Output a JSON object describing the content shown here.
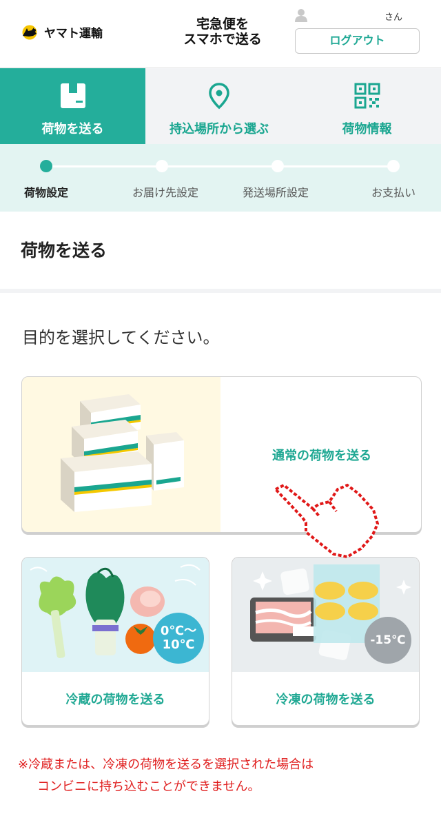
{
  "header": {
    "logo_text": "ヤマト運輸",
    "title_line1": "宅急便を",
    "title_line2": "スマホで送る",
    "user_suffix": "さん",
    "logout_label": "ログアウト"
  },
  "tabs": [
    {
      "label": "荷物を送る",
      "icon": "box-icon",
      "active": true
    },
    {
      "label": "持込場所から選ぶ",
      "icon": "location-pin-icon",
      "active": false
    },
    {
      "label": "荷物情報",
      "icon": "qr-code-icon",
      "active": false
    }
  ],
  "steps": [
    {
      "label": "荷物設定",
      "active": true
    },
    {
      "label": "お届け先設定",
      "active": false
    },
    {
      "label": "発送場所設定",
      "active": false
    },
    {
      "label": "お支払い",
      "active": false
    }
  ],
  "page_title": "荷物を送る",
  "instruction": "目的を選択してください。",
  "options": {
    "normal": {
      "label": "通常の荷物を送る"
    },
    "cold": {
      "label": "冷蔵の荷物を送る",
      "temp_line1": "0℃〜",
      "temp_line2": "10℃"
    },
    "frozen": {
      "label": "冷凍の荷物を送る",
      "temp": "-15℃"
    }
  },
  "notice": {
    "line1": "※冷蔵または、冷凍の荷物を送るを選択された場合は",
    "line2": "コンビニに持ち込むことができません。"
  },
  "colors": {
    "brand_green": "#24ae9b",
    "step_bg": "#e3f4f2",
    "notice_red": "#e02020",
    "pointer_red": "#e01818"
  }
}
